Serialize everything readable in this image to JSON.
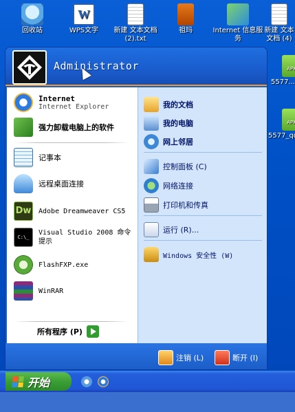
{
  "desktop": {
    "icons": [
      {
        "label": "回收站",
        "icon": "recycle-bin-icon"
      },
      {
        "label": "WPS文字",
        "icon": "wps-writer-icon"
      },
      {
        "label": "新建 文本文档 (2).txt",
        "icon": "text-file-icon"
      },
      {
        "label": "祖玛",
        "icon": "zuma-icon"
      },
      {
        "label": "Internet 信息服务",
        "icon": "iis-icon"
      },
      {
        "label": "新建 文本文档 (4)",
        "icon": "text-file-icon"
      },
      {
        "label": "5577...",
        "icon": "apk-icon"
      },
      {
        "label": "5577_qq",
        "icon": "apk-icon"
      }
    ],
    "wps_glyph": "W",
    "apk_badge": "APK"
  },
  "start_menu": {
    "user": "Administrator",
    "left_items": [
      {
        "title": "Internet",
        "subtitle": "Internet Explorer",
        "icon": "internet-explorer-icon"
      },
      {
        "title": "强力卸载电脑上的软件",
        "icon": "uninstaller-icon"
      },
      {
        "title": "记事本",
        "icon": "notepad-icon"
      },
      {
        "title": "远程桌面连接",
        "icon": "remote-desktop-icon"
      },
      {
        "title": "Adobe Dreamweaver CS5",
        "icon": "dreamweaver-icon"
      },
      {
        "title": "Visual Studio 2008 命令提示",
        "icon": "command-prompt-icon"
      },
      {
        "title": "FlashFXP.exe",
        "icon": "flashfxp-icon"
      },
      {
        "title": "WinRAR",
        "icon": "winrar-icon"
      }
    ],
    "all_programs": "所有程序 (P)",
    "right_items": [
      {
        "label": "我的文档",
        "icon": "my-documents-icon"
      },
      {
        "label": "我的电脑",
        "icon": "my-computer-icon"
      },
      {
        "label": "网上邻居",
        "icon": "network-places-icon"
      },
      {
        "label": "控制面板 (C)",
        "icon": "control-panel-icon"
      },
      {
        "label": "网络连接",
        "icon": "network-connections-icon"
      },
      {
        "label": "打印机和传真",
        "icon": "printers-icon"
      },
      {
        "label": "运行 (R)...",
        "icon": "run-icon"
      },
      {
        "label": "Windows 安全性 (W)",
        "icon": "windows-security-icon"
      }
    ],
    "logoff": "注销 (L)",
    "shutdown": "断开 (I)",
    "dreamweaver_glyph": "Dw",
    "cmd_glyph": "C:\\_"
  },
  "taskbar": {
    "start_label": "开始"
  },
  "colors": {
    "accent_orange": "#f39a2a",
    "menu_blue": "#1c5ec8",
    "right_pane": "#d3e5fa"
  }
}
